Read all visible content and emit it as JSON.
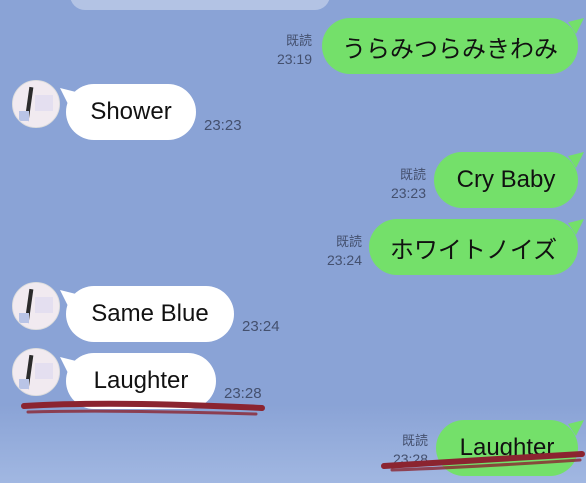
{
  "colors": {
    "background": "#8aa3d6",
    "sent_bubble": "#74e06a",
    "received_bubble": "#ffffff",
    "meta_text": "#44506e",
    "annotation_red": "#8b2430"
  },
  "messages": [
    {
      "side": "sent",
      "text": "うらみつらみきわみ",
      "read": "既読",
      "time": "23:19"
    },
    {
      "side": "received",
      "text": "Shower",
      "time": "23:23"
    },
    {
      "side": "sent",
      "text": "Cry Baby",
      "read": "既読",
      "time": "23:23"
    },
    {
      "side": "sent",
      "text": "ホワイトノイズ",
      "read": "既読",
      "time": "23:24"
    },
    {
      "side": "received",
      "text": "Same Blue",
      "time": "23:24"
    },
    {
      "side": "received",
      "text": "Laughter",
      "time": "23:28"
    },
    {
      "side": "sent",
      "text": "Laughter",
      "read": "既読",
      "time": "23:28"
    }
  ],
  "avatar": {
    "icon": "contact-avatar-icon"
  }
}
